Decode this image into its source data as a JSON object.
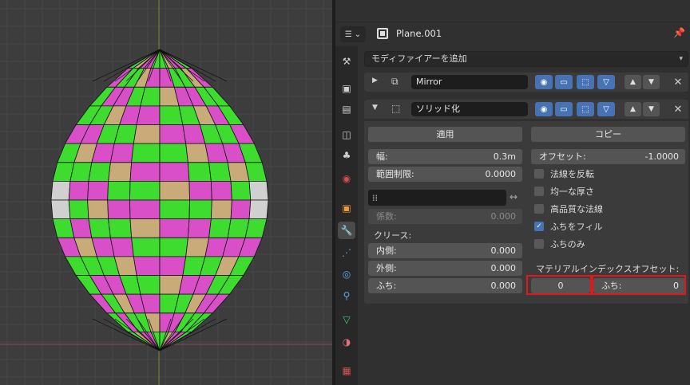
{
  "header": {
    "object_name": "Plane.001"
  },
  "add_modifier": {
    "label": "モディファイアーを追加"
  },
  "mirror_modifier": {
    "name": "Mirror"
  },
  "solidify_modifier": {
    "name": "ソリッド化",
    "apply_label": "適用",
    "copy_label": "コピー",
    "thickness": {
      "label": "幅:",
      "value": "0.3m"
    },
    "offset": {
      "label": "オフセット:",
      "value": "-1.0000"
    },
    "clamp": {
      "label": "範囲制限:",
      "value": "0.0000"
    },
    "factor": {
      "label": "係数:",
      "value": "0.000"
    },
    "crease_label": "クリース:",
    "crease_inner": {
      "label": "内側:",
      "value": "0.000"
    },
    "crease_outer": {
      "label": "外側:",
      "value": "0.000"
    },
    "crease_rim": {
      "label": "ふち:",
      "value": "0.000"
    },
    "checks": [
      {
        "label": "法線を反転",
        "checked": false
      },
      {
        "label": "均一な厚さ",
        "checked": false
      },
      {
        "label": "高品質な法線",
        "checked": false
      },
      {
        "label": "ふちをフィル",
        "checked": true
      },
      {
        "label": "ふちのみ",
        "checked": false
      }
    ],
    "material_offset_label": "マテリアルインデックスオフセット:",
    "material_offset": {
      "value": "0"
    },
    "material_rim": {
      "label": "ふち:",
      "value": "0"
    }
  },
  "colors": {
    "accent_blue": "#4772b3",
    "highlight_red": "#e4161b",
    "mesh_green": "#3edc2e",
    "mesh_magenta": "#d84fc8",
    "mesh_tan": "#c8ab78",
    "mesh_white": "#d0d0d0"
  },
  "icons": {
    "tabs": [
      "tool-icon",
      "render-icon",
      "output-icon",
      "view-layer-icon",
      "scene-icon",
      "world-icon",
      "object-icon",
      "modifier-icon",
      "particles-icon",
      "physics-icon",
      "constraints-icon",
      "data-icon",
      "material-icon",
      "texture-icon"
    ]
  }
}
